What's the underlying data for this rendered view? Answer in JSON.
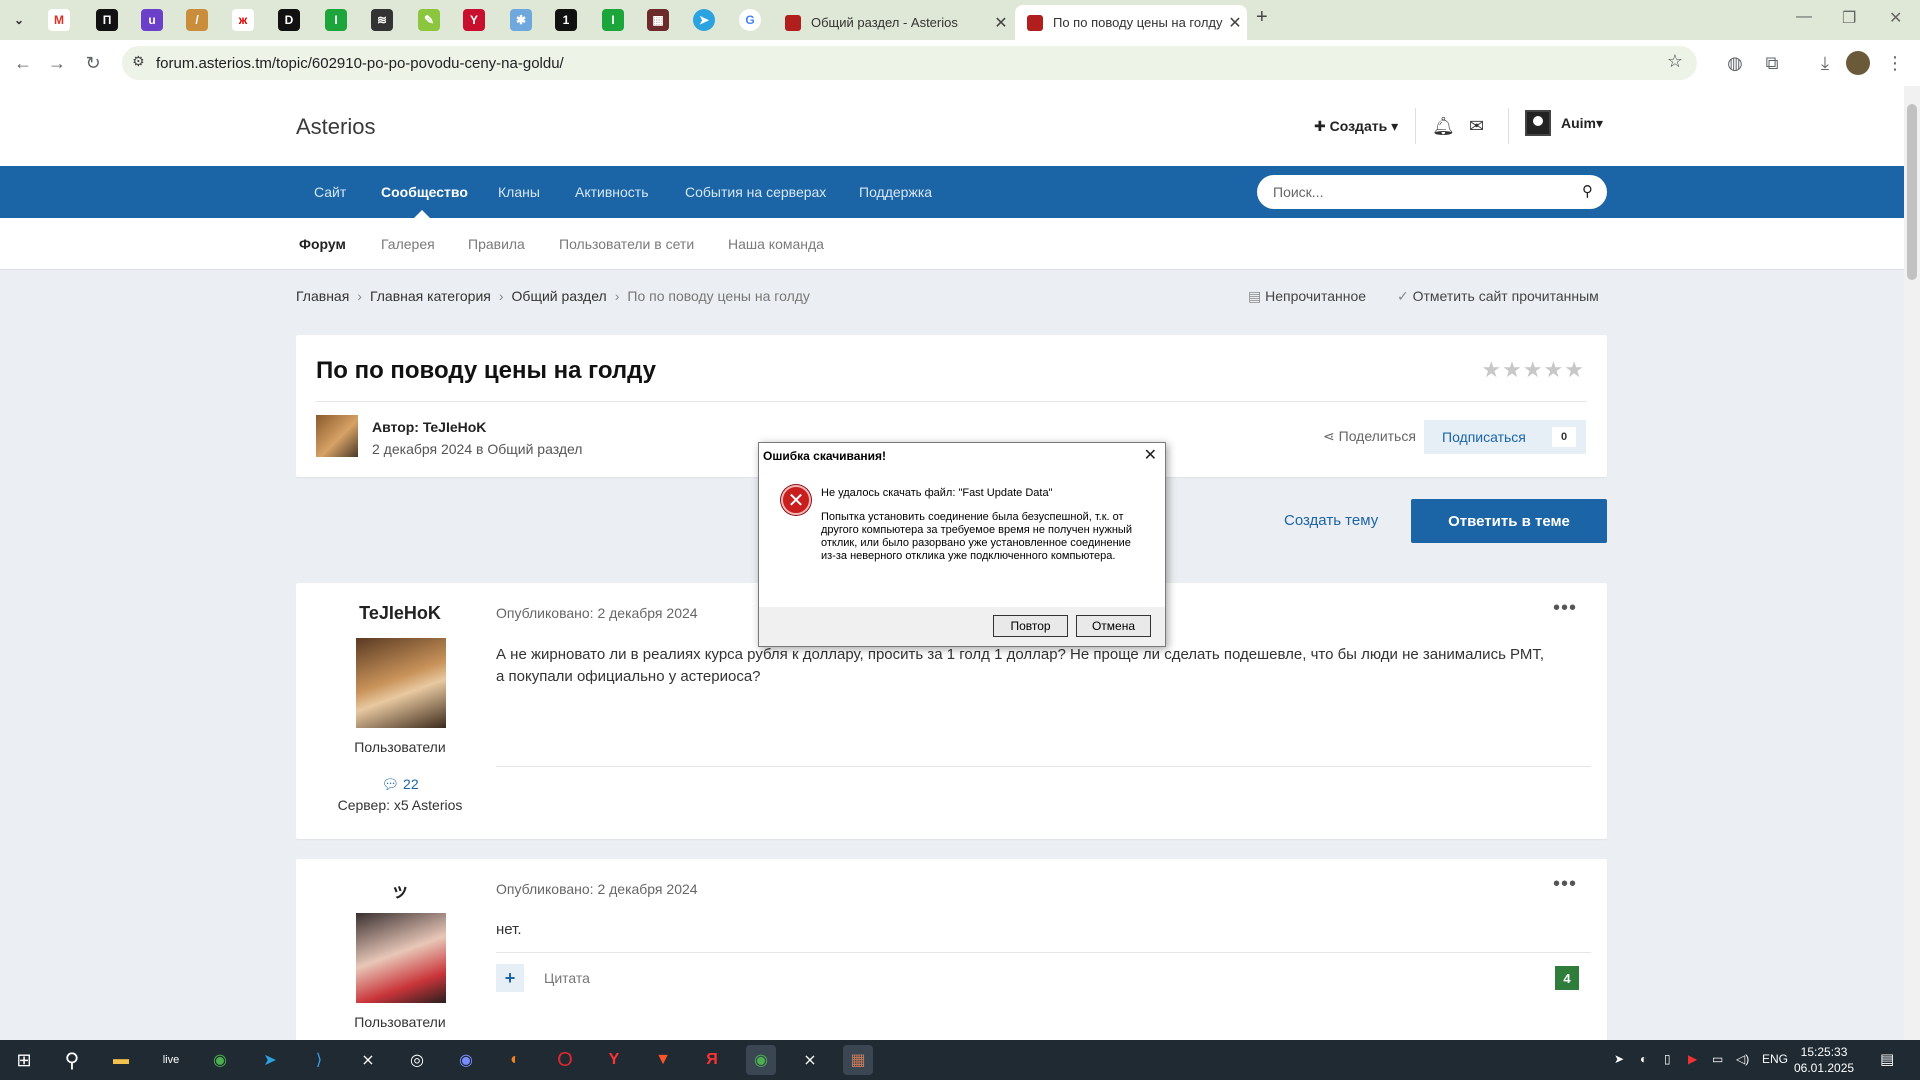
{
  "browser": {
    "tabs": [
      {
        "title": "Общий раздел - Asterios"
      },
      {
        "title": "По по поводу цены на голду -"
      }
    ],
    "url": "forum.asterios.tm/topic/602910-po-po-povodu-ceny-na-goldu/"
  },
  "header": {
    "logo": "Asterios",
    "create": "Создать",
    "user": "Auim"
  },
  "nav": {
    "items": [
      "Сайт",
      "Сообщество",
      "Кланы",
      "Активность",
      "События на серверах",
      "Поддержка"
    ],
    "search_placeholder": "Поиск..."
  },
  "subnav": {
    "items": [
      "Форум",
      "Галерея",
      "Правила",
      "Пользователи в сети",
      "Наша команда"
    ]
  },
  "breadcrumb": {
    "items": [
      "Главная",
      "Главная категория",
      "Общий раздел",
      "По по поводу цены на голду"
    ],
    "unread": "Непрочитанное",
    "mark_read": "Отметить сайт прочитанным"
  },
  "topic": {
    "title": "По по поводу цены на голду",
    "author": "Автор: TeJIeHoK",
    "date": "2 декабря 2024 в Общий раздел",
    "share": "Поделиться",
    "follow": "Подписаться",
    "follow_count": "0",
    "create_topic": "Создать тему",
    "reply": "Ответить в теме"
  },
  "posts": [
    {
      "author": "TeJIeHoK",
      "role": "Пользователи",
      "count": "22",
      "server": "Сервер: x5 Asterios",
      "date": "Опубликовано: 2 декабря 2024",
      "text": "А не жирновато ли в реалиях курса рубля к доллару, просить за 1 голд 1 доллар? Не проще ли сделать подешевле, что бы люди не занимались РМТ, а покупали официально у астериоса?"
    },
    {
      "author": "ッ",
      "role": "Пользователи",
      "date": "Опубликовано: 2 декабря 2024",
      "text": "нет.",
      "quote": "Цитата",
      "reactions": "4"
    }
  ],
  "dialog": {
    "title": "Ошибка скачивания!",
    "headline": "Не удалось скачать файл: \"Fast Update Data\"",
    "message": "Попытка установить соединение была безуспешной, т.к. от другого компьютера за требуемое время не получен нужный отклик, или было разорвано уже установленное соединение из-за неверного отклика уже подключенного компьютера.",
    "retry": "Повтор",
    "cancel": "Отмена"
  },
  "taskbar": {
    "lang": "ENG",
    "time": "15:25:33",
    "date": "06.01.2025"
  },
  "colors": {
    "nav_blue": "#1b65a6",
    "page_bg": "#ebeef2",
    "tabbar": "#dfe7d6",
    "reaction_green": "#2f7d3a"
  }
}
